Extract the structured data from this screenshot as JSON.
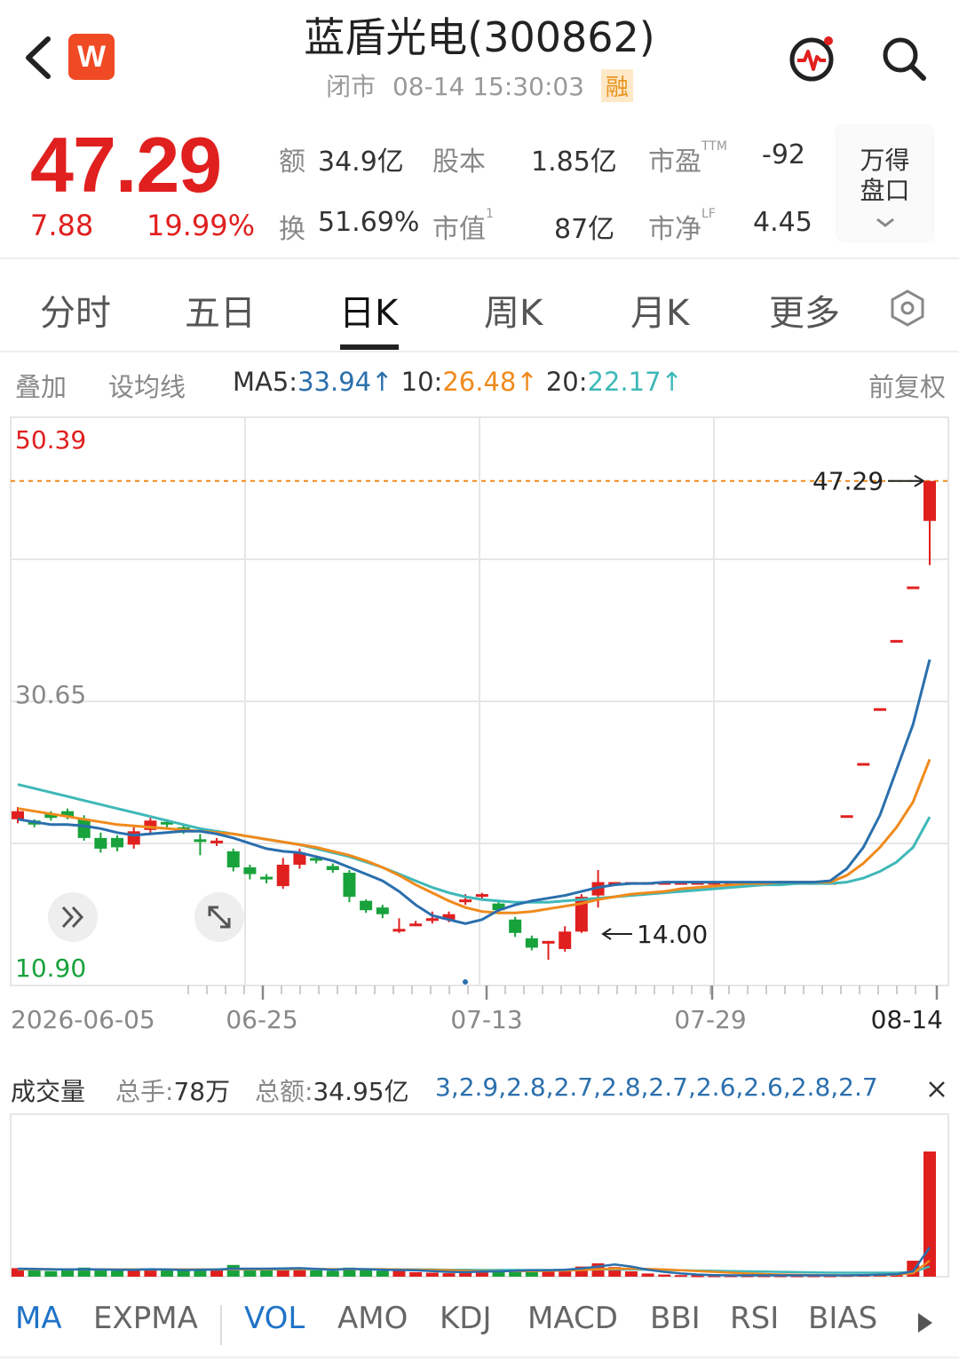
{
  "header": {
    "title": "蓝盾光电(300862)",
    "status": "闭市",
    "datetime": "08-14 15:30:03",
    "margin_tag": "融",
    "logo_letter": "W"
  },
  "quote": {
    "price": "47.29",
    "change": "7.88",
    "change_pct": "19.99%",
    "stats": [
      {
        "label": "额",
        "value": "34.9亿"
      },
      {
        "label": "股本",
        "value": "1.85亿"
      },
      {
        "label": "市盈",
        "sup": "TTM",
        "value": "-92"
      },
      {
        "label": "换",
        "value": "51.69%"
      },
      {
        "label": "市值",
        "sup": "1",
        "value": "87亿"
      },
      {
        "label": "市净",
        "sup": "LF",
        "value": "4.45"
      }
    ],
    "wind_button": [
      "万得",
      "盘口"
    ]
  },
  "tabs": [
    "分时",
    "五日",
    "日K",
    "周K",
    "月K",
    "更多"
  ],
  "ma_row": {
    "overlay": "叠加",
    "set_ma": "设均线",
    "ma5_label": "MA5:",
    "ma5": "33.94↑",
    "ma10_label": "10:",
    "ma10": "26.48↑",
    "ma20_label": "20:",
    "ma20": "22.17↑",
    "adjust": "前复权"
  },
  "colors": {
    "up": "#e0201f",
    "down": "#18a23c",
    "ma5": "#2a6fad",
    "ma10": "#f08a1c",
    "ma20": "#3fb8b8",
    "active_tab": "#1f73c7"
  },
  "chart_data": {
    "type": "candlestick",
    "y_labels": [
      "50.39",
      "30.65",
      "10.90"
    ],
    "ylim": [
      10.9,
      50.39
    ],
    "x_labels": [
      "2026-06-05",
      "06-25",
      "07-13",
      "07-29",
      "08-14"
    ],
    "last_price_label": "47.29",
    "min_label": "14.00",
    "candles": [
      {
        "o": 22.0,
        "c": 22.6,
        "h": 22.9,
        "l": 21.7
      },
      {
        "o": 21.9,
        "c": 21.6,
        "h": 22.0,
        "l": 21.4
      },
      {
        "o": 22.4,
        "c": 22.1,
        "h": 22.6,
        "l": 21.9
      },
      {
        "o": 22.6,
        "c": 22.2,
        "h": 22.8,
        "l": 22.0
      },
      {
        "o": 22.0,
        "c": 20.6,
        "h": 22.3,
        "l": 20.4
      },
      {
        "o": 20.6,
        "c": 19.8,
        "h": 21.0,
        "l": 19.5
      },
      {
        "o": 20.6,
        "c": 19.9,
        "h": 20.8,
        "l": 19.6
      },
      {
        "o": 20.1,
        "c": 21.1,
        "h": 21.4,
        "l": 19.8
      },
      {
        "o": 21.2,
        "c": 21.9,
        "h": 22.1,
        "l": 20.9
      },
      {
        "o": 21.8,
        "c": 21.6,
        "h": 22.0,
        "l": 21.3
      },
      {
        "o": 21.4,
        "c": 21.2,
        "h": 21.6,
        "l": 20.9
      },
      {
        "o": 20.5,
        "c": 20.4,
        "h": 20.9,
        "l": 19.3
      },
      {
        "o": 20.2,
        "c": 20.4,
        "h": 20.6,
        "l": 20.0
      },
      {
        "o": 19.6,
        "c": 18.4,
        "h": 19.8,
        "l": 18.1
      },
      {
        "o": 18.4,
        "c": 17.9,
        "h": 18.6,
        "l": 17.5
      },
      {
        "o": 17.7,
        "c": 17.5,
        "h": 17.9,
        "l": 17.2
      },
      {
        "o": 17.0,
        "c": 18.6,
        "h": 19.1,
        "l": 16.8
      },
      {
        "o": 18.6,
        "c": 19.5,
        "h": 19.8,
        "l": 18.3
      },
      {
        "o": 19.1,
        "c": 18.9,
        "h": 19.3,
        "l": 18.7
      },
      {
        "o": 18.5,
        "c": 18.2,
        "h": 18.7,
        "l": 18.0
      },
      {
        "o": 18.0,
        "c": 16.2,
        "h": 18.2,
        "l": 15.8
      },
      {
        "o": 15.9,
        "c": 15.2,
        "h": 16.0,
        "l": 15.0
      },
      {
        "o": 15.4,
        "c": 14.9,
        "h": 15.6,
        "l": 14.6
      },
      {
        "o": 13.6,
        "c": 13.8,
        "h": 14.6,
        "l": 13.5
      },
      {
        "o": 14.2,
        "c": 14.2,
        "h": 14.4,
        "l": 14.0
      },
      {
        "o": 14.4,
        "c": 14.6,
        "h": 15.1,
        "l": 14.2
      },
      {
        "o": 14.5,
        "c": 14.9,
        "h": 15.1,
        "l": 14.3
      },
      {
        "o": 15.8,
        "c": 16.0,
        "h": 16.4,
        "l": 15.6
      },
      {
        "o": 16.2,
        "c": 16.4,
        "h": 16.5,
        "l": 16.0
      },
      {
        "o": 15.7,
        "c": 15.2,
        "h": 15.9,
        "l": 14.9
      },
      {
        "o": 14.5,
        "c": 13.5,
        "h": 14.7,
        "l": 13.2
      },
      {
        "o": 13.1,
        "c": 12.4,
        "h": 13.3,
        "l": 12.2
      },
      {
        "o": 12.8,
        "c": 12.9,
        "h": 12.9,
        "l": 11.5
      },
      {
        "o": 12.3,
        "c": 13.6,
        "h": 14.0,
        "l": 12.1
      },
      {
        "o": 13.6,
        "c": 16.2,
        "h": 16.4,
        "l": 13.5
      },
      {
        "o": 16.3,
        "c": 17.3,
        "h": 18.2,
        "l": 15.4
      },
      {
        "o": 17.3,
        "c": 17.3,
        "h": 17.3,
        "l": 17.3
      },
      {
        "o": 17.3,
        "c": 17.3,
        "h": 17.3,
        "l": 17.3
      },
      {
        "o": 17.3,
        "c": 17.3,
        "h": 17.3,
        "l": 17.3
      },
      {
        "o": 17.3,
        "c": 17.3,
        "h": 17.3,
        "l": 17.3
      },
      {
        "o": 17.3,
        "c": 17.3,
        "h": 17.3,
        "l": 17.3
      },
      {
        "o": 17.3,
        "c": 17.3,
        "h": 17.3,
        "l": 17.3
      },
      {
        "o": 17.3,
        "c": 17.3,
        "h": 17.3,
        "l": 17.3
      },
      {
        "o": 17.3,
        "c": 17.3,
        "h": 17.3,
        "l": 17.3
      },
      {
        "o": 17.3,
        "c": 17.3,
        "h": 17.3,
        "l": 17.3
      },
      {
        "o": 17.3,
        "c": 17.3,
        "h": 17.3,
        "l": 17.3
      },
      {
        "o": 17.3,
        "c": 17.3,
        "h": 17.3,
        "l": 17.3
      },
      {
        "o": 17.3,
        "c": 17.3,
        "h": 17.3,
        "l": 17.3
      },
      {
        "o": 17.3,
        "c": 17.3,
        "h": 17.3,
        "l": 17.3
      },
      {
        "o": 17.3,
        "c": 17.3,
        "h": 17.3,
        "l": 17.3
      },
      {
        "o": 22.3,
        "c": 22.3,
        "h": 22.3,
        "l": 22.3
      },
      {
        "o": 26.2,
        "c": 26.2,
        "h": 26.2,
        "l": 26.2
      },
      {
        "o": 30.3,
        "c": 30.3,
        "h": 30.3,
        "l": 30.3
      },
      {
        "o": 35.4,
        "c": 35.4,
        "h": 35.4,
        "l": 35.4
      },
      {
        "o": 39.4,
        "c": 39.4,
        "h": 39.4,
        "l": 39.4
      },
      {
        "o": 44.3,
        "c": 47.29,
        "h": 47.29,
        "l": 41.0
      }
    ],
    "ma5": [
      22.0,
      21.8,
      21.6,
      21.6,
      21.5,
      21.3,
      21.0,
      20.8,
      20.9,
      21.0,
      21.1,
      21.1,
      20.9,
      20.6,
      20.2,
      19.8,
      19.6,
      19.5,
      19.2,
      18.9,
      18.4,
      17.9,
      17.4,
      16.6,
      15.6,
      14.8,
      14.5,
      14.2,
      14.5,
      15.2,
      15.6,
      15.9,
      16.1,
      16.3,
      16.6,
      16.9,
      17.1,
      17.2,
      17.2,
      17.3,
      17.3,
      17.3,
      17.3,
      17.3,
      17.3,
      17.3,
      17.3,
      17.3,
      17.3,
      17.4,
      18.3,
      19.9,
      22.3,
      25.7,
      29.1,
      33.94
    ],
    "ma10": [
      22.8,
      22.6,
      22.4,
      22.2,
      22.0,
      21.8,
      21.6,
      21.5,
      21.4,
      21.3,
      21.2,
      21.1,
      21.0,
      20.9,
      20.7,
      20.5,
      20.3,
      20.1,
      19.9,
      19.6,
      19.3,
      18.9,
      18.4,
      17.8,
      17.1,
      16.5,
      15.9,
      15.4,
      15.1,
      15.0,
      15.0,
      15.1,
      15.3,
      15.5,
      15.7,
      16.0,
      16.2,
      16.4,
      16.5,
      16.6,
      16.8,
      16.9,
      17.0,
      17.1,
      17.2,
      17.2,
      17.3,
      17.3,
      17.3,
      17.3,
      17.8,
      18.7,
      19.9,
      21.4,
      23.3,
      26.48
    ],
    "ma20": [
      24.6,
      24.3,
      24.0,
      23.7,
      23.4,
      23.1,
      22.8,
      22.5,
      22.2,
      21.9,
      21.6,
      21.3,
      21.1,
      20.9,
      20.7,
      20.5,
      20.3,
      20.1,
      19.8,
      19.5,
      19.2,
      18.8,
      18.4,
      17.9,
      17.4,
      16.9,
      16.5,
      16.2,
      16.0,
      15.9,
      15.8,
      15.8,
      15.8,
      15.9,
      16.0,
      16.1,
      16.2,
      16.3,
      16.4,
      16.5,
      16.6,
      16.7,
      16.8,
      16.9,
      17.0,
      17.1,
      17.1,
      17.2,
      17.2,
      17.2,
      17.3,
      17.6,
      18.1,
      18.8,
      19.9,
      22.17
    ]
  },
  "volume": {
    "title": "成交量",
    "total_hands_label": "总手:",
    "total_hands": "78万",
    "total_amount_label": "总额:",
    "total_amount": "34.95亿",
    "vma5": [
      3.0,
      2.9,
      2.8,
      2.7,
      2.8,
      2.7,
      2.6,
      2.6,
      2.8,
      2.7,
      2.5,
      2.6,
      2.7,
      3.0,
      3.0,
      3.0,
      3.1,
      3.2,
      2.9,
      2.6,
      2.9,
      2.8,
      2.6,
      2.5,
      2.4,
      2.1,
      1.8,
      1.7,
      1.9,
      2.0,
      2.2,
      2.4,
      2.4,
      2.6,
      3.1,
      3.8,
      4.6,
      3.8,
      2.6,
      1.8,
      1.2,
      0.8,
      0.6,
      0.5,
      0.5,
      0.5,
      0.5,
      0.5,
      0.5,
      0.5,
      0.5,
      0.6,
      0.7,
      0.9,
      2.0,
      11.0
    ],
    "vma10": [
      2.8,
      2.8,
      2.8,
      2.7,
      2.7,
      2.7,
      2.7,
      2.7,
      2.7,
      2.7,
      2.7,
      2.7,
      2.7,
      2.8,
      2.8,
      2.8,
      2.9,
      2.9,
      2.9,
      2.8,
      2.8,
      2.8,
      2.8,
      2.7,
      2.6,
      2.5,
      2.4,
      2.2,
      2.1,
      2.1,
      2.1,
      2.1,
      2.2,
      2.3,
      2.5,
      2.8,
      3.0,
      3.0,
      2.9,
      2.7,
      2.4,
      2.1,
      1.8,
      1.5,
      1.2,
      1.0,
      0.8,
      0.7,
      0.6,
      0.5,
      0.5,
      0.6,
      0.6,
      0.8,
      1.3,
      6.0
    ],
    "vma20": [
      2.7,
      2.7,
      2.7,
      2.7,
      2.7,
      2.7,
      2.7,
      2.7,
      2.7,
      2.7,
      2.7,
      2.7,
      2.7,
      2.7,
      2.7,
      2.7,
      2.7,
      2.8,
      2.8,
      2.8,
      2.8,
      2.8,
      2.8,
      2.7,
      2.7,
      2.7,
      2.6,
      2.6,
      2.5,
      2.5,
      2.5,
      2.5,
      2.5,
      2.5,
      2.6,
      2.7,
      2.7,
      2.7,
      2.6,
      2.5,
      2.4,
      2.3,
      2.2,
      2.1,
      2.0,
      1.9,
      1.8,
      1.7,
      1.6,
      1.5,
      1.5,
      1.5,
      1.5,
      1.5,
      1.7,
      3.8
    ],
    "volumes": [
      3.2,
      2.6,
      2.1,
      2.4,
      3.4,
      2.8,
      2.2,
      2.6,
      3.0,
      2.4,
      2.2,
      2.9,
      2.4,
      4.4,
      2.8,
      2.4,
      3.2,
      2.9,
      2.4,
      2.2,
      3.4,
      2.7,
      2.2,
      2.3,
      1.7,
      1.5,
      1.3,
      1.6,
      2.2,
      2.4,
      2.8,
      2.6,
      2.1,
      2.4,
      3.8,
      5.0,
      3.6,
      2.0,
      1.2,
      0.8,
      0.6,
      0.5,
      0.5,
      0.5,
      0.5,
      0.5,
      0.5,
      0.5,
      0.5,
      0.5,
      0.6,
      0.8,
      1.1,
      1.5,
      6.0,
      47.0
    ]
  },
  "indicators": [
    "MA",
    "EXPMA",
    "VOL",
    "AMO",
    "KDJ",
    "MACD",
    "BBI",
    "RSI",
    "BIAS"
  ]
}
